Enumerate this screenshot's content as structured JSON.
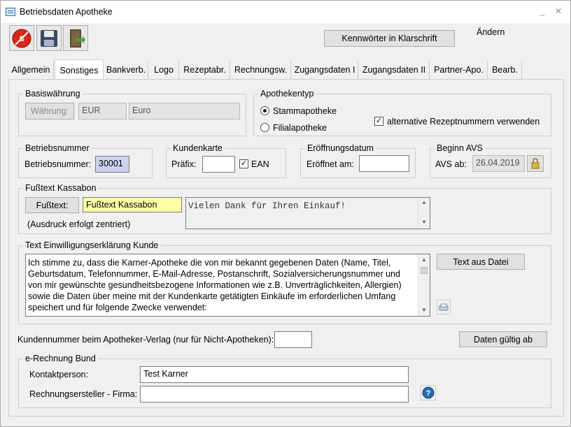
{
  "window": {
    "title": "Betriebsdaten Apotheke",
    "minimize": "_",
    "close": "✕"
  },
  "toolbar": {
    "plaintext_button": "Kennwörter in Klarschrift",
    "mode": "Ändern"
  },
  "tabs": [
    "Allgemein",
    "Sonstiges",
    "Bankverb.",
    "Logo",
    "Rezeptabr.",
    "Rechnungsw.",
    "Zugangsdaten I",
    "Zugangsdaten II",
    "Partner-Apo.",
    "Bearb."
  ],
  "basiswaehrung": {
    "title": "Basiswährung",
    "button": "Währung:",
    "code": "EUR",
    "name": "Euro"
  },
  "apothekentyp": {
    "title": "Apothekentyp",
    "option1": "Stammapotheke",
    "option2": "Filialapotheke",
    "checkbox": "alternative Rezeptnummern verwenden"
  },
  "betriebsnummer": {
    "title": "Betriebsnummer",
    "label": "Betriebsnummer:",
    "value": "30001"
  },
  "kundenkarte": {
    "title": "Kundenkarte",
    "prefix_label": "Präfix:",
    "prefix_value": "",
    "ean_label": "EAN"
  },
  "eroeffnung": {
    "title": "Eröffnungsdatum",
    "label": "Eröffnet am:",
    "value": ""
  },
  "avs": {
    "title": "Beginn AVS",
    "label": "AVS ab:",
    "value": "26.04.2019"
  },
  "fusstext": {
    "title": "Fußtext Kassabon",
    "button": "Fußtext:",
    "value": "Fußtext Kassabon",
    "note": "(Ausdruck erfolgt zentriert)",
    "text": "Vielen Dank für Ihren Einkauf!"
  },
  "einwilligung": {
    "title": "Text Einwilligungserklärung Kunde",
    "text": "Ich stimme zu, dass die Karner-Apotheke die von mir bekannt gegebenen Daten (Name, Titel, Geburtsdatum, Telefonnummer, E-Mail-Adresse, Postanschrift, Sozialversicherungsnummer und von mir gewünschte gesundheitsbezogene Informationen wie z.B. Unverträglichkeiten, Allergien) sowie die Daten über meine mit der Kundenkarte getätigten Einkäufe im erforderlichen Umfang speichert und für folgende Zwecke verwendet:",
    "button": "Text aus Datei"
  },
  "kundennummer": {
    "label": "Kundennummer beim Apotheker-Verlag (nur für Nicht-Apotheken):",
    "value": "",
    "button": "Daten gültig ab"
  },
  "erechnung": {
    "title": "e-Rechnung Bund",
    "contact_label": "Kontaktperson:",
    "contact_value": "Test Karner",
    "firm_label": "Rechnungsersteller - Firma:",
    "firm_value": ""
  },
  "colors": {
    "accent": "#2b6cb0",
    "yellow": "#ffffa8"
  }
}
